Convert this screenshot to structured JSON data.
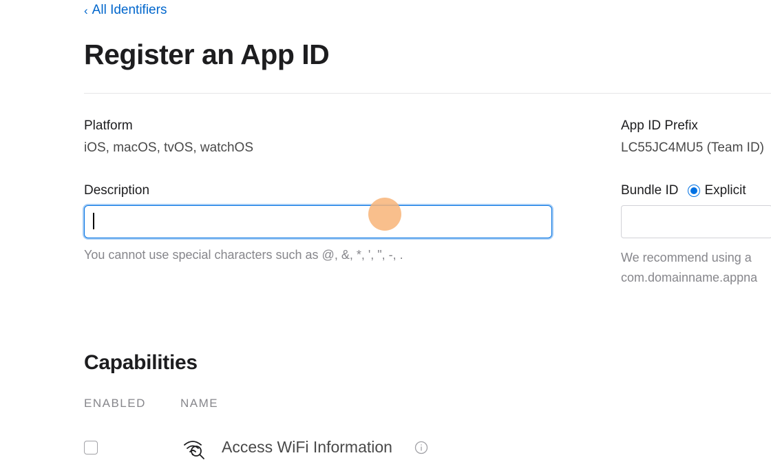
{
  "nav": {
    "back_label": "All Identifiers"
  },
  "page": {
    "title": "Register an App ID"
  },
  "platform": {
    "label": "Platform",
    "value": "iOS, macOS, tvOS, watchOS"
  },
  "prefix": {
    "label": "App ID Prefix",
    "value": "LC55JC4MU5 (Team ID)"
  },
  "description": {
    "label": "Description",
    "value": "",
    "helper": "You cannot use special characters such as @, &, *, ', \", -, ."
  },
  "bundle": {
    "label": "Bundle ID",
    "radio_label": "Explicit",
    "radio_selected": true,
    "value": "",
    "helper_line1": "We recommend using a ",
    "helper_line2": "com.domainname.appna"
  },
  "capabilities": {
    "section_title": "Capabilities",
    "col_enabled": "ENABLED",
    "col_name": "NAME",
    "items": [
      {
        "name": "Access WiFi Information",
        "enabled": false,
        "icon": "wifi-search-icon"
      }
    ]
  }
}
